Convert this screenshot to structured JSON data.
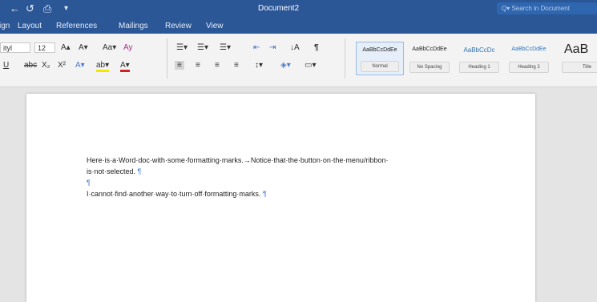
{
  "quick_access": {
    "undo_glyph": "←",
    "redo_glyph": "↺",
    "print_glyph": "⎙",
    "more_glyph": "▾"
  },
  "window": {
    "title": "Document2"
  },
  "search": {
    "placeholder": "Q▾ Search in Document"
  },
  "tabs": [
    "ign",
    "Layout",
    "References",
    "Mailings",
    "Review",
    "View"
  ],
  "ribbon": {
    "font_name": "ityl",
    "font_size": "12",
    "grow_font": "A▴",
    "shrink_font": "A▾",
    "change_case": "Aa▾",
    "clear_format": "Ay",
    "underline": "U",
    "strikethrough": "abc",
    "subscript": "X₂",
    "superscript": "X²",
    "text_effects": "A▾",
    "highlight": "ab▾",
    "font_color": "A▾",
    "bullets": "☰▾",
    "numbering": "☰▾",
    "multilevel": "☰▾",
    "decrease_indent": "⇤",
    "increase_indent": "⇥",
    "sort": "↓A",
    "show_marks": "¶",
    "line_spacing": "↕▾",
    "shading": "◈▾",
    "borders": "▭▾",
    "align_left": "≡",
    "align_center": "≡",
    "align_right": "≡",
    "justify": "≡"
  },
  "styles": [
    {
      "sample": "AaBbCcDdEe",
      "label": "Normal",
      "sample_color": "#222222"
    },
    {
      "sample": "AaBbCcDdEe",
      "label": "No Spacing",
      "sample_color": "#222222"
    },
    {
      "sample": "AaBbCcDc",
      "label": "Heading 1",
      "sample_color": "#2e74b5"
    },
    {
      "sample": "AaBbCcDdEe",
      "label": "Heading 2",
      "sample_color": "#2e74b5"
    },
    {
      "sample": "AaB",
      "label": "Title",
      "sample_color": "#222222"
    }
  ],
  "document": {
    "para1_line1": "Here·is·a·Word·doc·with·some·formatting·marks.→Notice·that·the·button·on·the·menu/ribbon·",
    "para1_line2": "is·not·selected.",
    "para_mark": "¶",
    "para3": "I·cannot·find·another·way·to·turn·off·formatting·marks."
  }
}
